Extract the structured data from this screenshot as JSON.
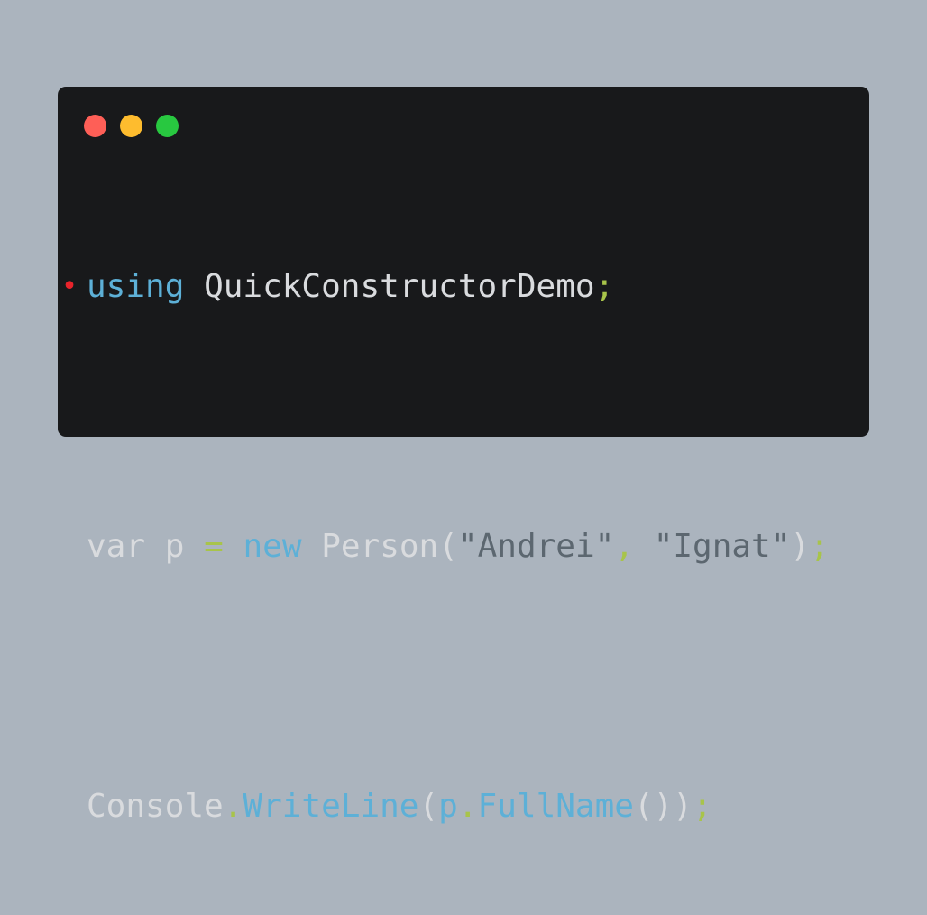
{
  "window": {
    "controls": [
      {
        "name": "close",
        "color": "#fe5f57"
      },
      {
        "name": "minimize",
        "color": "#febc2e"
      },
      {
        "name": "zoom",
        "color": "#28c840"
      }
    ]
  },
  "code": {
    "line1": {
      "marker": "•",
      "kw_using": "using",
      "namespace": "QuickConstructorDemo",
      "semicolon": ";"
    },
    "line2": {
      "kw_var": "var",
      "ident_p": "p",
      "op_eq": "=",
      "kw_new": "new",
      "type_person": "Person",
      "open_paren": "(",
      "str_first": "\"Andrei\"",
      "comma": ",",
      "str_last": "\"Ignat\"",
      "close_paren": ")",
      "semicolon": ";"
    },
    "line3": {
      "class_console": "Console",
      "dot1": ".",
      "method_writeline": "WriteLine",
      "open_paren": "(",
      "ident_p": "p",
      "dot2": ".",
      "method_fullname": "FullName",
      "call_parens": "())",
      "semicolon": ";"
    }
  },
  "colors": {
    "background": "#abb4be",
    "editor": "#18191b",
    "keyword": "#5db0d7",
    "identifier": "#d9dbde",
    "punctuation": "#a8c44a",
    "string": "#5c6770",
    "marker": "#e8232b"
  }
}
